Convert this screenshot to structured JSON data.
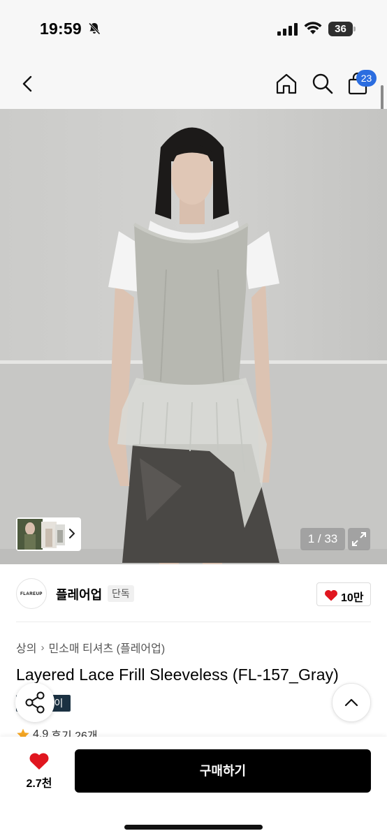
{
  "status_bar": {
    "time": "19:59",
    "battery": "36",
    "battery_level_percent": 36,
    "icons": [
      "bell-slash-icon",
      "cellular-signal-icon",
      "wifi-icon",
      "battery-icon"
    ]
  },
  "header": {
    "icons": [
      "chevron-left-icon",
      "home-icon",
      "search-icon",
      "shopping-bag-icon"
    ],
    "cart_count": "23"
  },
  "gallery": {
    "counter": "1 / 33",
    "icons": [
      "chevron-right-icon",
      "expand-icon"
    ]
  },
  "brand": {
    "logo_text": "FLAREUP",
    "name": "플레어업",
    "tag": "단독",
    "likes": "10만",
    "heart_color": "#e0161f"
  },
  "product": {
    "breadcrumb": [
      "상의",
      "민소매 티셔츠 (플레어업)"
    ],
    "title": "Layered Lace Frill Sleeveless (FL-157_Gray)",
    "badge": "이",
    "rating": "4.9",
    "reviews": "후기 26개"
  },
  "bottom_bar": {
    "wish_count": "2.7천",
    "buy_label": "구매하기"
  },
  "colors": {
    "accent_badge": "#2b6de0",
    "buy_button": "#000000",
    "badge_navy": "#1b3142",
    "star": "#f5a623"
  }
}
